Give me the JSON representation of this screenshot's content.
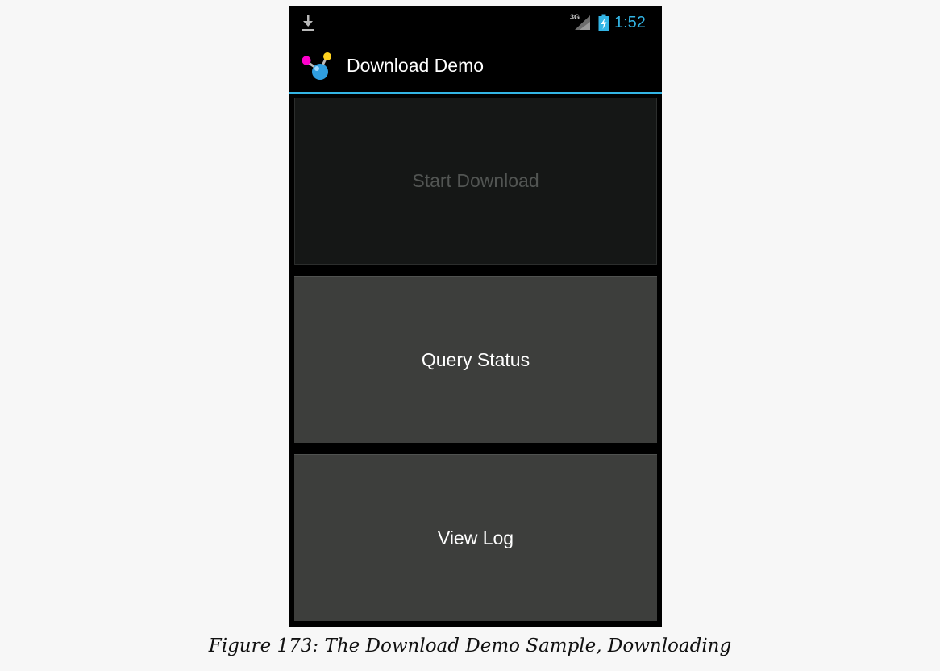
{
  "status_bar": {
    "notification_icon": "download-icon",
    "network_label": "3G",
    "battery_icon": "battery-charging-icon",
    "time": "1:52",
    "accent_color": "#33b5e5"
  },
  "action_bar": {
    "app_icon": "app-logo-icon",
    "title": "Download Demo"
  },
  "buttons": {
    "start_download": {
      "label": "Start Download",
      "enabled": false
    },
    "query_status": {
      "label": "Query Status",
      "enabled": true
    },
    "view_log": {
      "label": "View Log",
      "enabled": true
    }
  },
  "caption": "Figure 173: The Download Demo Sample, Downloading"
}
